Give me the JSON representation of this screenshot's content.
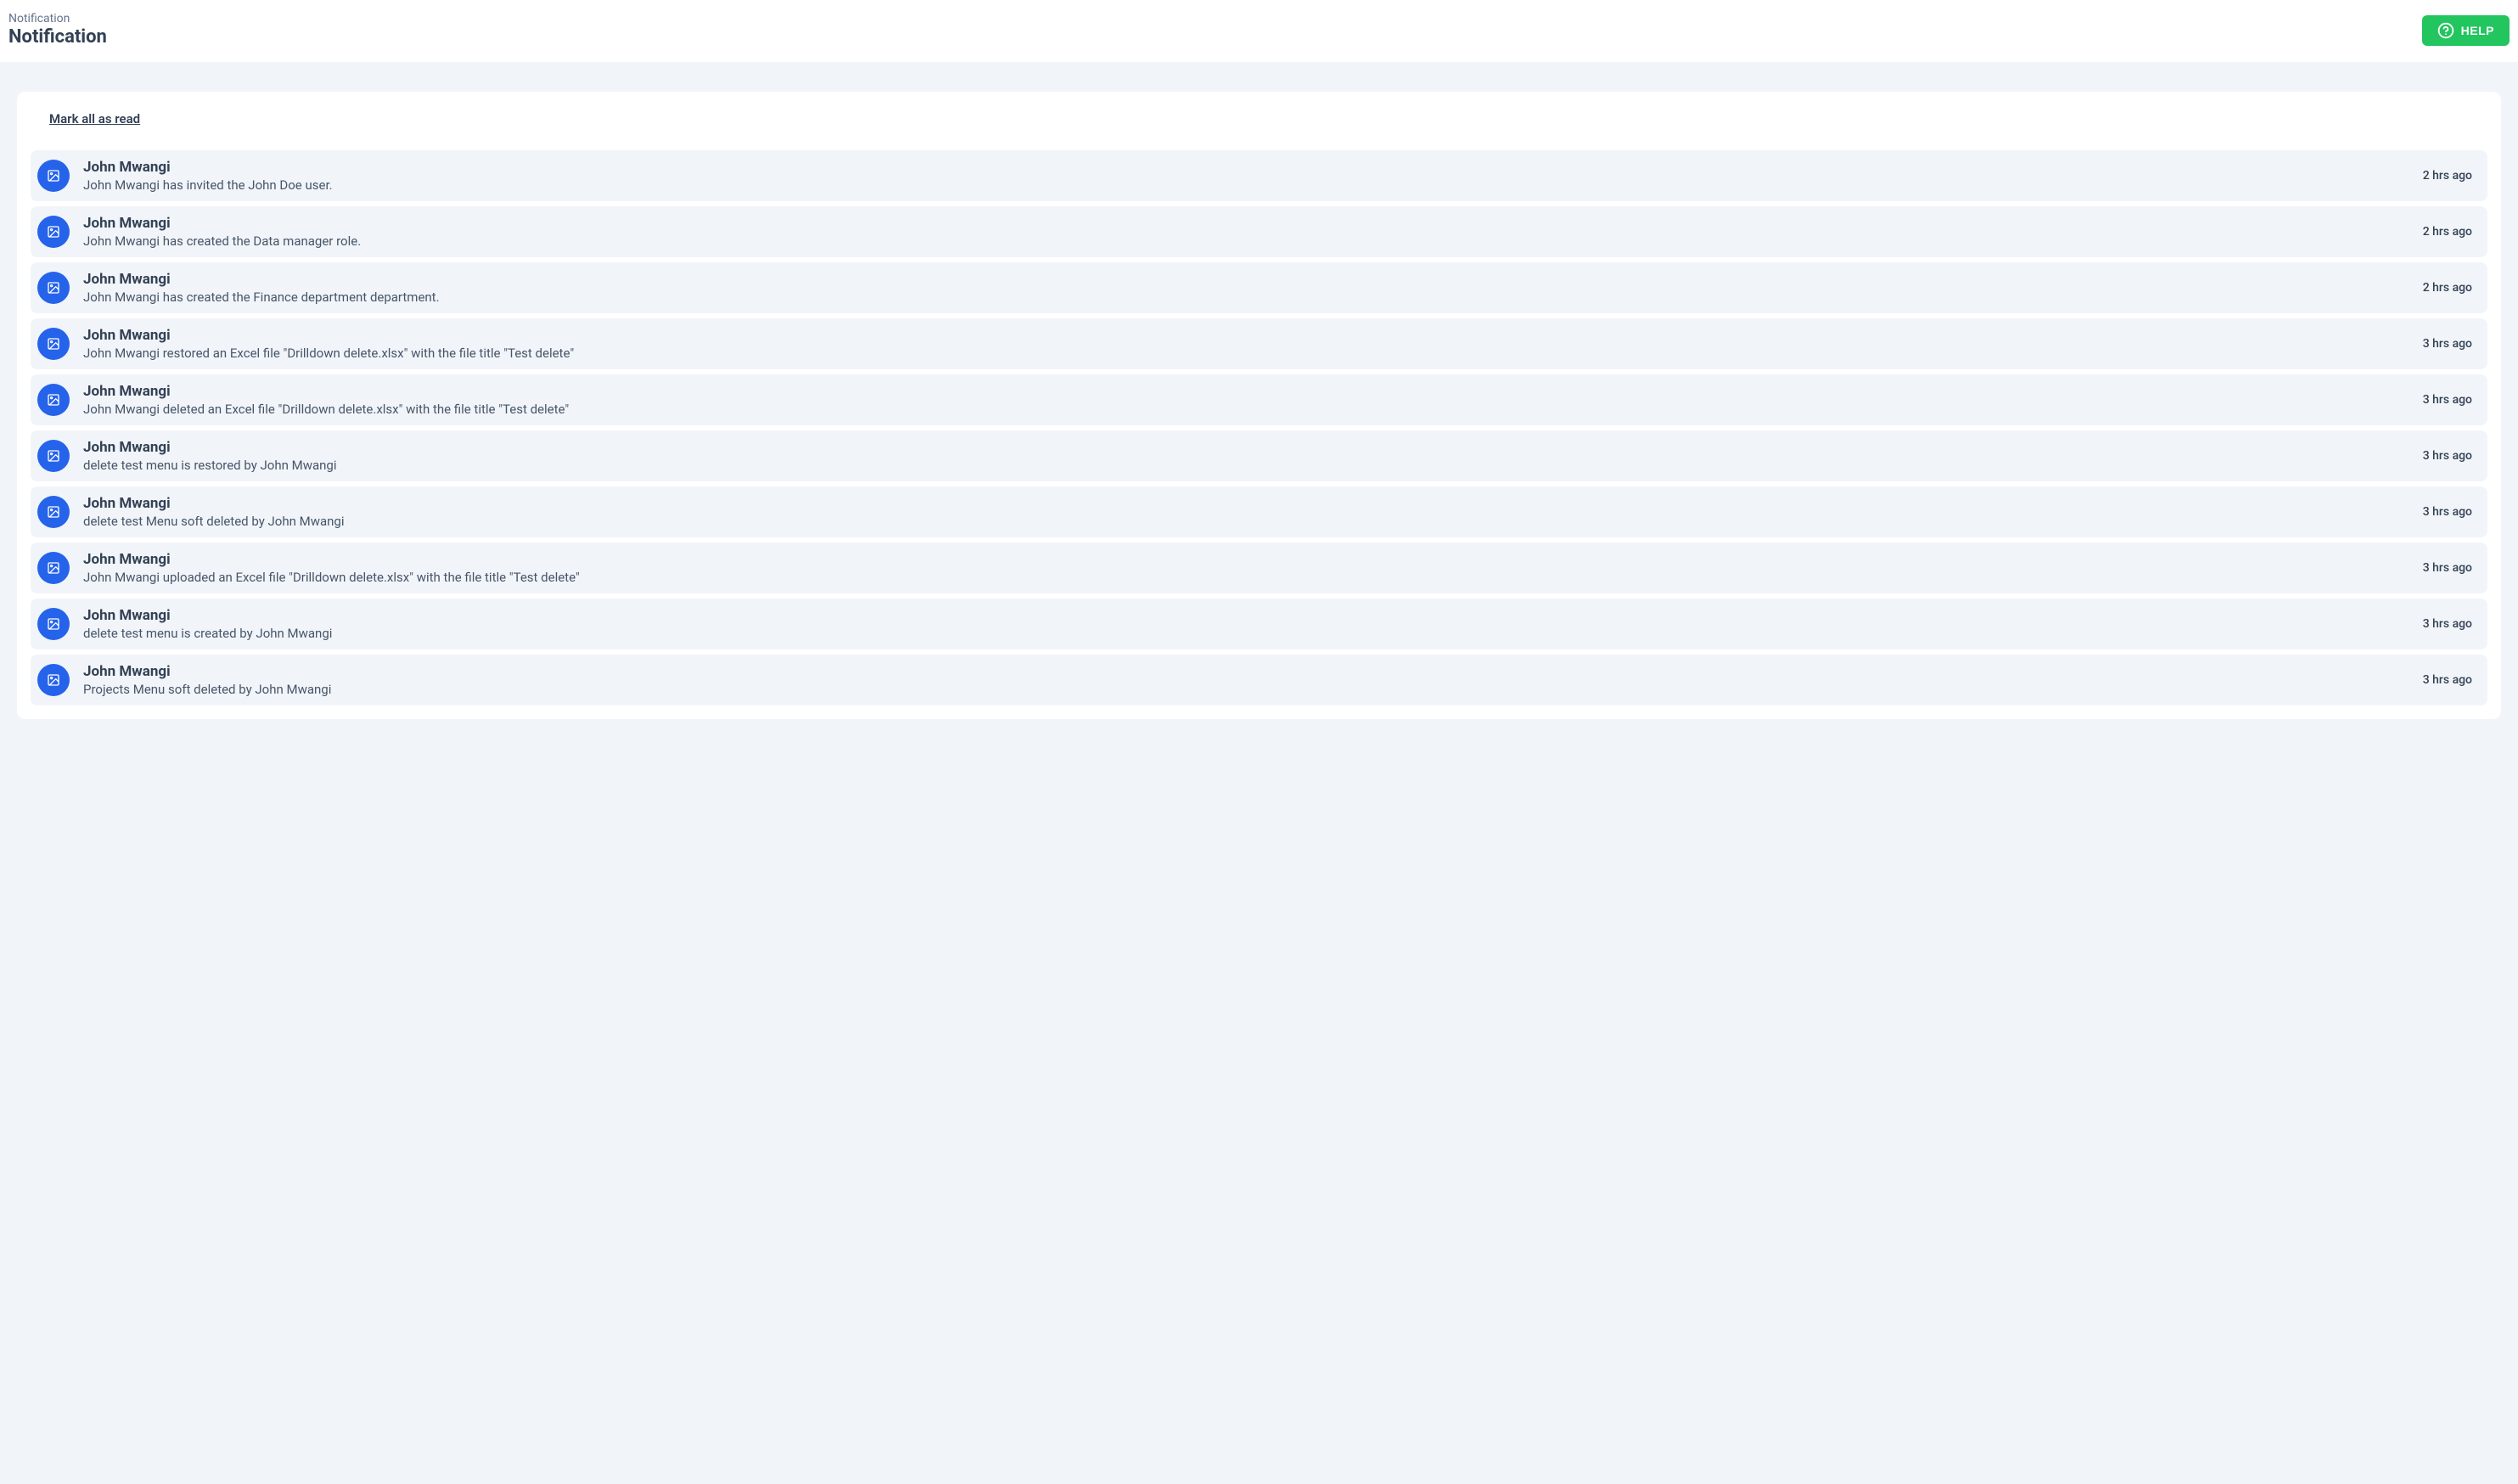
{
  "header": {
    "breadcrumb": "Notification",
    "title": "Notification",
    "help_label": "HELP"
  },
  "panel": {
    "mark_all_read_label": "Mark all as read"
  },
  "notifications": [
    {
      "user": "John Mwangi",
      "message": "John Mwangi has invited the John Doe user.",
      "time": "2 hrs ago"
    },
    {
      "user": "John Mwangi",
      "message": "John Mwangi has created the Data manager role.",
      "time": "2 hrs ago"
    },
    {
      "user": "John Mwangi",
      "message": "John Mwangi has created the Finance department department.",
      "time": "2 hrs ago"
    },
    {
      "user": "John Mwangi",
      "message": "John Mwangi restored an Excel file \"Drilldown delete.xlsx\" with the file title \"Test delete\"",
      "time": "3 hrs ago"
    },
    {
      "user": "John Mwangi",
      "message": "John Mwangi deleted an Excel file \"Drilldown delete.xlsx\" with the file title \"Test delete\"",
      "time": "3 hrs ago"
    },
    {
      "user": "John Mwangi",
      "message": "delete test menu is restored by John Mwangi",
      "time": "3 hrs ago"
    },
    {
      "user": "John Mwangi",
      "message": "delete test Menu soft deleted by John Mwangi",
      "time": "3 hrs ago"
    },
    {
      "user": "John Mwangi",
      "message": "John Mwangi uploaded an Excel file \"Drilldown delete.xlsx\" with the file title \"Test delete\"",
      "time": "3 hrs ago"
    },
    {
      "user": "John Mwangi",
      "message": "delete test menu is created by John Mwangi",
      "time": "3 hrs ago"
    },
    {
      "user": "John Mwangi",
      "message": "Projects Menu soft deleted by John Mwangi",
      "time": "3 hrs ago"
    }
  ]
}
